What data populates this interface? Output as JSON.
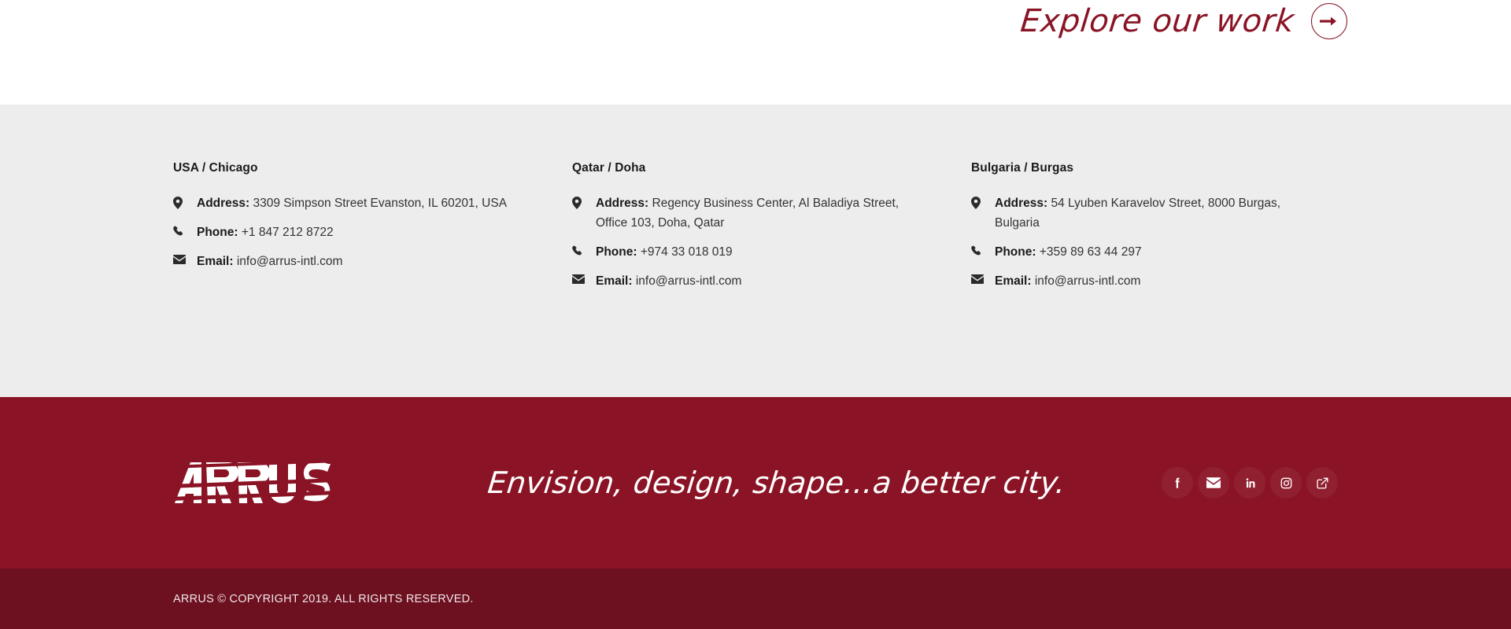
{
  "top": {
    "explore_label": "Explore our work",
    "arrow_icon": "arrow-right-icon"
  },
  "contact": {
    "columns": [
      {
        "title": "USA / Chicago",
        "rows": [
          {
            "icon": "location-pin-icon",
            "label": "Address:",
            "value": "3309 Simpson Street Evanston, IL 60201, USA"
          },
          {
            "icon": "phone-icon",
            "label": "Phone:",
            "value": "+1 847 212 8722"
          },
          {
            "icon": "envelope-icon",
            "label": "Email:",
            "value": "info@arrus-intl.com"
          }
        ]
      },
      {
        "title": "Qatar / Doha",
        "rows": [
          {
            "icon": "location-pin-icon",
            "label": "Address:",
            "value": "Regency Business Center, Al Baladiya Street, Office 103, Doha, Qatar"
          },
          {
            "icon": "phone-icon",
            "label": "Phone:",
            "value": "+974 33 018 019"
          },
          {
            "icon": "envelope-icon",
            "label": "Email:",
            "value": "info@arrus-intl.com"
          }
        ]
      },
      {
        "title": "Bulgaria / Burgas",
        "rows": [
          {
            "icon": "location-pin-icon",
            "label": "Address:",
            "value": "54 Lyuben Karavelov Street, 8000 Burgas, Bulgaria"
          },
          {
            "icon": "phone-icon",
            "label": "Phone:",
            "value": "+359 89 63 44 297"
          },
          {
            "icon": "envelope-icon",
            "label": "Email:",
            "value": "info@arrus-intl.com"
          }
        ]
      }
    ]
  },
  "footer": {
    "logo_text": "ARRUS",
    "tagline": "Envision, design, shape...a better city.",
    "socials": [
      {
        "name": "facebook-icon",
        "label": "Facebook"
      },
      {
        "name": "envelope-icon",
        "label": "Email"
      },
      {
        "name": "linkedin-icon",
        "label": "LinkedIn"
      },
      {
        "name": "instagram-icon",
        "label": "Instagram"
      },
      {
        "name": "external-link-icon",
        "label": "External link"
      }
    ],
    "copyright": "ARRUS © COPYRIGHT 2019. ALL RIGHTS RESERVED."
  },
  "colors": {
    "brand_maroon": "#8a1425",
    "footer_dark": "#6d1020",
    "contact_bg": "#ededed",
    "text_dark": "#333333"
  }
}
